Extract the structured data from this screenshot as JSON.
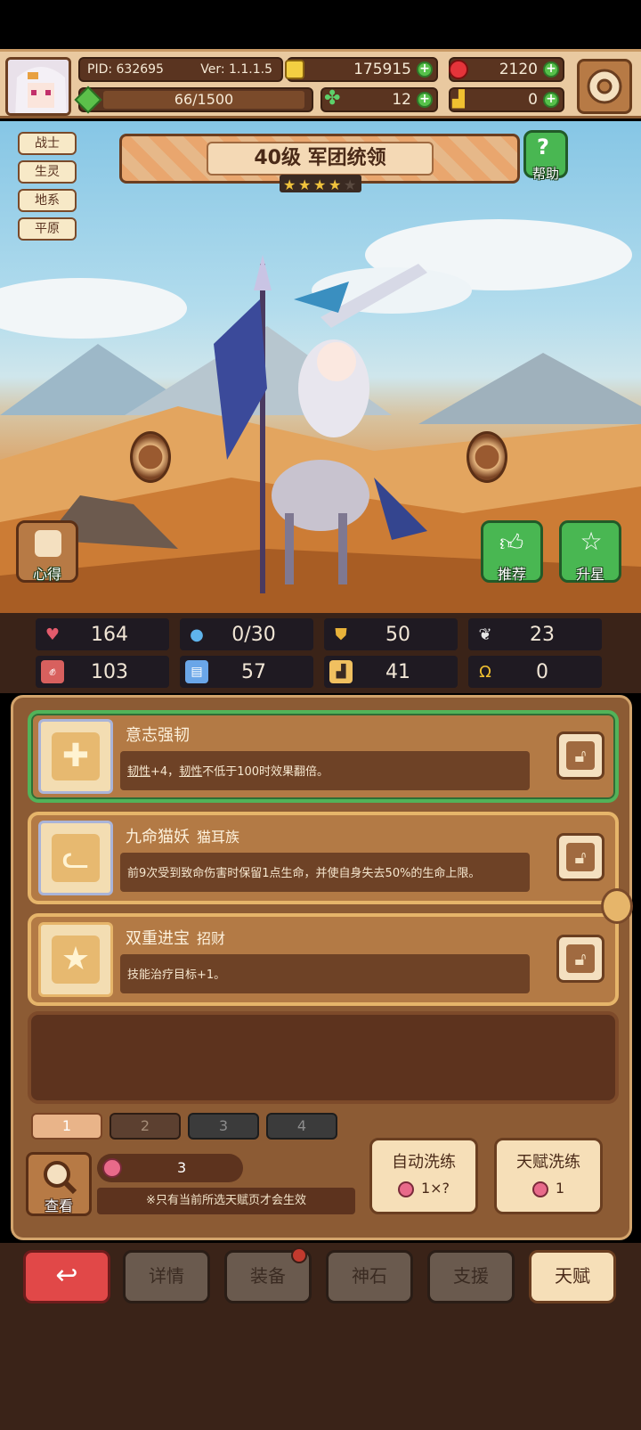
{
  "header": {
    "pid": "PID: 632695",
    "version": "Ver: 1.1.1.5",
    "gold": "175915",
    "gems": "2120",
    "energy": "66/1500",
    "clover": "12",
    "shoes": "0"
  },
  "class_tags": [
    "战士",
    "生灵",
    "地系",
    "平原"
  ],
  "hero": {
    "title": "40级  军团统领",
    "stars_filled": 4,
    "stars_total": 5,
    "help_label": "帮助"
  },
  "scene_buttons": {
    "tips": "心得",
    "recommend": "推荐",
    "star_up": "升星"
  },
  "stats": [
    {
      "icon": "heart-icon",
      "value": "164",
      "color": "#e35b6c"
    },
    {
      "icon": "drop-icon",
      "value": "0/30",
      "color": "#5fb4ec"
    },
    {
      "icon": "shield-icon",
      "value": "50",
      "color": "#e8b23a"
    },
    {
      "icon": "wing-icon",
      "value": "23",
      "color": "#e5e5e5"
    },
    {
      "icon": "fist-icon",
      "value": "103",
      "color": "#d8605e"
    },
    {
      "icon": "book-icon",
      "value": "57",
      "color": "#6aa6e8"
    },
    {
      "icon": "boot-icon",
      "value": "41",
      "color": "#f0c060"
    },
    {
      "icon": "horseshoe-icon",
      "value": "0",
      "color": "#f0c030"
    }
  ],
  "talents": [
    {
      "name": "意志强韧",
      "sub": "",
      "desc_a": "韧性",
      "desc_b": "+4，",
      "desc_c": "韧性",
      "desc_d": "不低于100时效果翻倍。",
      "icon": "cross-icon"
    },
    {
      "name": "九命猫妖",
      "sub": "猫耳族",
      "desc": "前9次受到致命伤害时保留1点生命，并使自身失去50%的生命上限。",
      "icon": "cat-icon"
    },
    {
      "name": "双重进宝",
      "sub": "招财",
      "desc": "技能治疗目标+1。",
      "icon": "star-icon"
    }
  ],
  "pages": [
    "1",
    "2",
    "3",
    "4"
  ],
  "bottom_panel": {
    "view_label": "查看",
    "peach_count": "3",
    "note": "※只有当前所选天赋页才会生效",
    "auto_wash": {
      "label": "自动洗练",
      "cost": "1×?"
    },
    "talent_wash": {
      "label": "天赋洗练",
      "cost": "1"
    }
  },
  "nav": {
    "details": "详情",
    "equipment": "装备",
    "godstone": "神石",
    "support": "支援",
    "talent": "天赋"
  }
}
